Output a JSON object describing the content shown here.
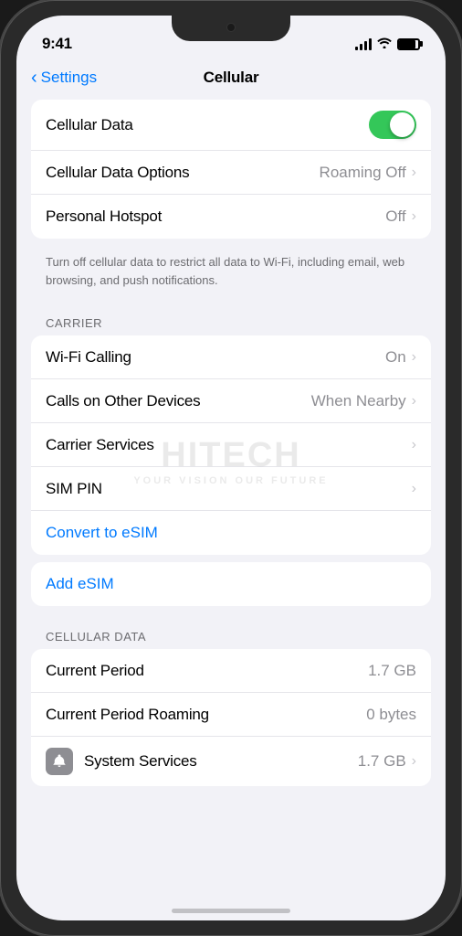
{
  "status_bar": {
    "time": "9:41",
    "signal_bars": [
      4,
      7,
      10,
      13
    ],
    "battery_level": 85
  },
  "nav": {
    "back_label": "Settings",
    "title": "Cellular"
  },
  "main_section": {
    "rows": [
      {
        "label": "Cellular Data",
        "type": "toggle",
        "value": true
      },
      {
        "label": "Cellular Data Options",
        "value": "Roaming Off",
        "type": "nav"
      },
      {
        "label": "Personal Hotspot",
        "value": "Off",
        "type": "nav"
      }
    ],
    "description": "Turn off cellular data to restrict all data to Wi-Fi, including email, web browsing, and push notifications."
  },
  "carrier_section": {
    "header": "CARRIER",
    "rows": [
      {
        "label": "Wi-Fi Calling",
        "value": "On",
        "type": "nav"
      },
      {
        "label": "Calls on Other Devices",
        "value": "When Nearby",
        "type": "nav"
      },
      {
        "label": "Carrier Services",
        "value": "",
        "type": "nav"
      },
      {
        "label": "SIM PIN",
        "value": "",
        "type": "nav"
      }
    ],
    "link_row": {
      "label": "Convert to eSIM",
      "type": "link"
    }
  },
  "esim_section": {
    "link_row": {
      "label": "Add eSIM",
      "type": "link"
    }
  },
  "cellular_data_section": {
    "header": "CELLULAR DATA",
    "rows": [
      {
        "label": "Current Period",
        "value": "1.7 GB",
        "type": "static"
      },
      {
        "label": "Current Period Roaming",
        "value": "0 bytes",
        "type": "static"
      },
      {
        "label": "System Services",
        "value": "1.7 GB",
        "type": "nav",
        "has_icon": true
      }
    ]
  }
}
